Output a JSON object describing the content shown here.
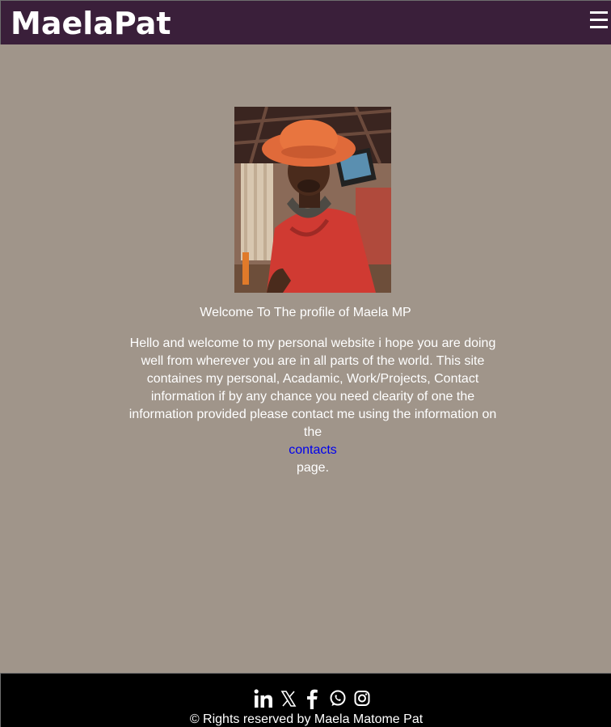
{
  "header": {
    "brand": "MaelaPat",
    "menu_icon": "hamburger-menu-icon",
    "background_color": "#3a1f3a"
  },
  "main": {
    "background_color": "#a0958a",
    "profile_photo_icon": "profile-photo",
    "welcome_heading": "Welcome To The profile of Maela MP",
    "intro_text": "Hello and welcome to my personal website i hope you are doing well from wherever you are in all parts of the world. This site containes my personal, Acadamic, Work/Projects, Contact information if by any chance you need clearity of one the information provided please contact me using the information on the",
    "contacts_link": "contacts",
    "intro_suffix": "page.",
    "link_color": "#0000ee"
  },
  "footer": {
    "background_color": "#000000",
    "social_icons": [
      "linkedin-icon",
      "x-twitter-icon",
      "facebook-icon",
      "whatsapp-icon",
      "instagram-icon"
    ],
    "copyright": "© Rights reserved by Maela Matome Pat"
  }
}
